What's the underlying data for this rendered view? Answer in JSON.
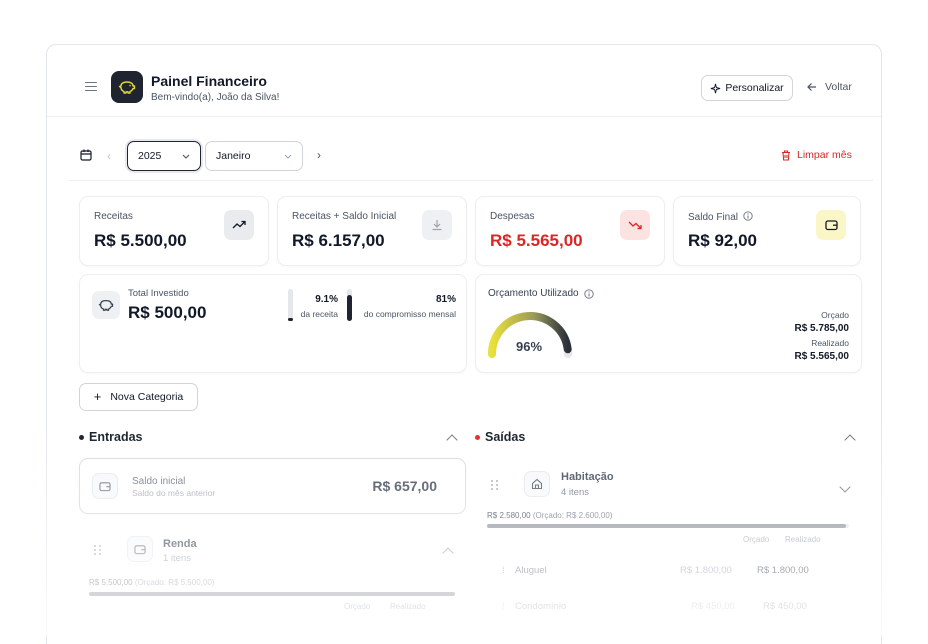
{
  "header": {
    "title": "Painel Financeiro",
    "subtitle": "Bem-vindo(a), João da Silva!",
    "personalize_label": "Personalizar",
    "back_label": "Voltar"
  },
  "period": {
    "year": "2025",
    "month": "Janeiro",
    "clear_label": "Limpar mês"
  },
  "stats": [
    {
      "label": "Receitas",
      "value": "R$ 5.500,00",
      "icon": "trending-up-icon"
    },
    {
      "label": "Receitas + Saldo Inicial",
      "value": "R$ 6.157,00",
      "icon": "download-icon"
    },
    {
      "label": "Despesas",
      "value": "R$ 5.565,00",
      "icon": "trending-down-icon"
    },
    {
      "label": "Saldo Final",
      "value": "R$ 92,00",
      "icon": "wallet-icon"
    }
  ],
  "investment": {
    "label": "Total Investido",
    "value": "R$ 500,00",
    "pct_income": "9.1%",
    "pct_income_label": "da receita",
    "pct_income_fraction": 0.091,
    "pct_commit": "81%",
    "pct_commit_label": "do compromisso mensal",
    "pct_commit_fraction": 0.81
  },
  "budget": {
    "title": "Orçamento Utilizado",
    "percent": "96%",
    "fraction": 0.96,
    "planned_label": "Orçado",
    "planned_value": "R$ 5.785,00",
    "actual_label": "Realizado",
    "actual_value": "R$ 5.565,00"
  },
  "new_category_label": "Nova Categoria",
  "entradas": {
    "title": "Entradas",
    "opening": {
      "title": "Saldo inicial",
      "subtitle": "Saldo do mês anterior",
      "value": "R$ 657,00"
    },
    "category": {
      "name": "Renda",
      "count": "1 itens",
      "summary": "R$ 5.500,00",
      "budget_note": "(Orçado: R$ 5.500,00)",
      "fraction": 1.0,
      "col_planned": "Orçado",
      "col_actual": "Realizado"
    }
  },
  "saidas": {
    "title": "Saídas",
    "category": {
      "name": "Habitação",
      "count": "4 itens",
      "summary": "R$ 2.580,00",
      "budget_note": "(Orçado: R$ 2.600,00)",
      "fraction": 0.992,
      "col_planned": "Orçado",
      "col_actual": "Realizado",
      "items": [
        {
          "name": "Aluguel",
          "planned": "R$ 1.800,00",
          "actual": "R$ 1.800,00"
        },
        {
          "name": "Condomínio",
          "planned": "R$ 450,00",
          "actual": "R$ 450,00"
        }
      ]
    }
  },
  "colors": {
    "accent": "#e2d93a",
    "danger": "#dc2626",
    "dark": "#1f2430"
  }
}
